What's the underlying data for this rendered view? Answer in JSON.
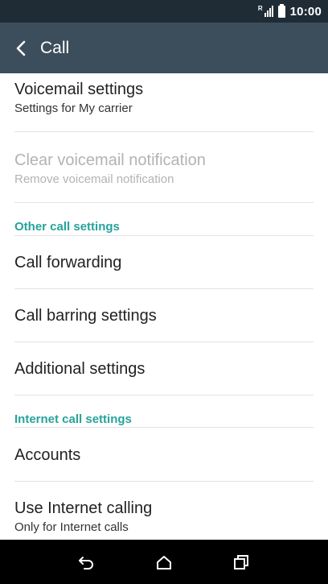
{
  "status_bar": {
    "network_letter": "R",
    "time": "10:00",
    "icons": [
      "roaming-signal-icon",
      "battery-icon"
    ]
  },
  "app_bar": {
    "title": "Call",
    "back_icon": "chevron-left-icon"
  },
  "settings": {
    "voicemail": {
      "title": "Voicemail settings",
      "subtitle": "Settings for My carrier"
    },
    "clear_voicemail": {
      "title": "Clear voicemail notification",
      "subtitle": "Remove voicemail notification",
      "enabled": false
    },
    "other_header": "Other call settings",
    "call_forwarding": {
      "title": "Call forwarding"
    },
    "call_barring": {
      "title": "Call barring settings"
    },
    "additional": {
      "title": "Additional settings"
    },
    "internet_header": "Internet call settings",
    "accounts": {
      "title": "Accounts"
    },
    "use_internet": {
      "title": "Use Internet calling",
      "subtitle": "Only for Internet calls"
    }
  },
  "nav_bar": {
    "icons": [
      "back-icon",
      "home-icon",
      "recents-icon"
    ]
  },
  "colors": {
    "status_bar": "#1f2b35",
    "app_bar": "#3c4e5c",
    "section_accent": "#26a39a",
    "nav_bar": "#000000"
  }
}
